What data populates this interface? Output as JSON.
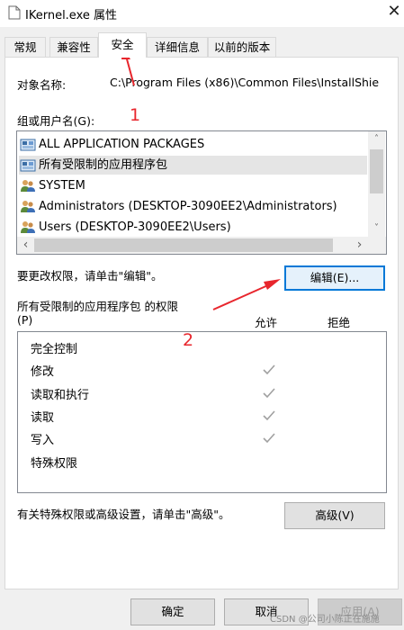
{
  "window": {
    "title": "IKernel.exe 属性",
    "close_label": "✕"
  },
  "tabs": [
    {
      "label": "常规",
      "active": false
    },
    {
      "label": "兼容性",
      "active": false
    },
    {
      "label": "安全",
      "active": true
    },
    {
      "label": "详细信息",
      "active": false
    },
    {
      "label": "以前的版本",
      "active": false
    }
  ],
  "object": {
    "label": "对象名称:",
    "value": "C:\\Program Files (x86)\\Common Files\\InstallShie"
  },
  "groups": {
    "label": "组或用户名(G):",
    "items": [
      {
        "name": "ALL APPLICATION PACKAGES",
        "icon": "app-package-icon",
        "selected": false
      },
      {
        "name": "所有受限制的应用程序包",
        "icon": "app-package-icon",
        "selected": true
      },
      {
        "name": "SYSTEM",
        "icon": "users-group-icon",
        "selected": false
      },
      {
        "name": "Administrators (DESKTOP-3090EE2\\Administrators)",
        "icon": "users-group-icon",
        "selected": false
      },
      {
        "name": "Users (DESKTOP-3090EE2\\Users)",
        "icon": "users-group-icon",
        "selected": false
      }
    ],
    "scroll_left": "‹",
    "scroll_right": "›",
    "scroll_up": "˄",
    "scroll_down": "˅"
  },
  "change_hint": "要更改权限，请单击\"编辑\"。",
  "edit_button": "编辑(E)...",
  "permissions": {
    "title": "所有受限制的应用程序包 的权限",
    "p_label": "(P)",
    "allow_header": "允许",
    "deny_header": "拒绝",
    "rows": [
      {
        "name": "完全控制",
        "allow": false,
        "deny": false
      },
      {
        "name": "修改",
        "allow": true,
        "deny": false
      },
      {
        "name": "读取和执行",
        "allow": true,
        "deny": false
      },
      {
        "name": "读取",
        "allow": true,
        "deny": false
      },
      {
        "name": "写入",
        "allow": true,
        "deny": false
      },
      {
        "name": "特殊权限",
        "allow": false,
        "deny": false
      }
    ]
  },
  "advanced_hint": "有关特殊权限或高级设置，请单击\"高级\"。",
  "advanced_button": "高级(V)",
  "footer": {
    "ok": "确定",
    "cancel": "取消",
    "apply": "应用(A)"
  },
  "annotations": {
    "one": "1",
    "two": "2",
    "color": "#e8262d"
  },
  "watermark": "CSDN @公司小陈正在施施"
}
